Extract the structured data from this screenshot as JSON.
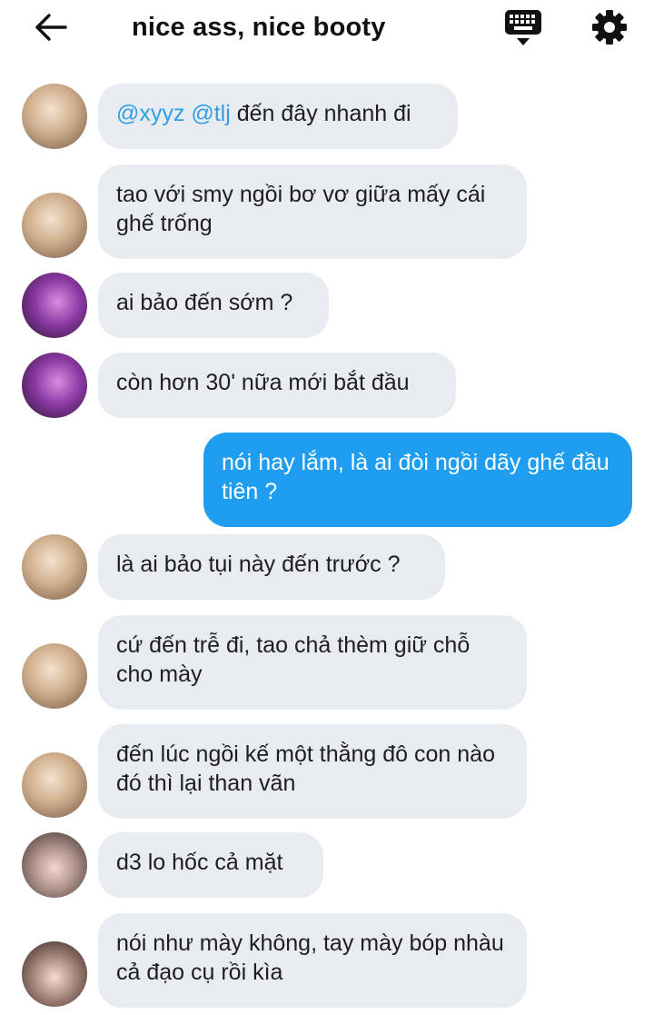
{
  "header": {
    "title": "nice ass, nice booty",
    "back_icon": "arrow-left-icon",
    "keyboard_icon": "keyboard-hide-icon",
    "settings_icon": "gear-icon"
  },
  "colors": {
    "incoming_bubble": "#e8ecf1",
    "outgoing_bubble": "#1f9ef1",
    "mention": "#2e9ee6"
  },
  "messages": [
    {
      "mentions": [
        "@xyyz",
        "@tlj"
      ],
      "text": "đến đây nhanh đi"
    },
    {
      "text": "tao với smy ngồi bơ vơ giữa mấy cái ghế trống"
    },
    {
      "text": "ai bảo đến sớm ?"
    },
    {
      "text": "còn hơn 30' nữa mới bắt đầu"
    },
    {
      "text": "nói hay lắm, là ai đòi ngồi dãy ghế đầu tiên ?"
    },
    {
      "text": "là ai bảo tụi này đến trước ?"
    },
    {
      "text": "cứ đến trễ đi, tao chả thèm giữ chỗ cho mày"
    },
    {
      "text": "đến lúc ngồi kế một thằng đô con nào đó thì lại than vãn"
    },
    {
      "text": "d3 lo hốc cả mặt"
    },
    {
      "text": "nói như mày không, tay mày bóp nhàu cả đạo cụ rồi kìa"
    }
  ]
}
